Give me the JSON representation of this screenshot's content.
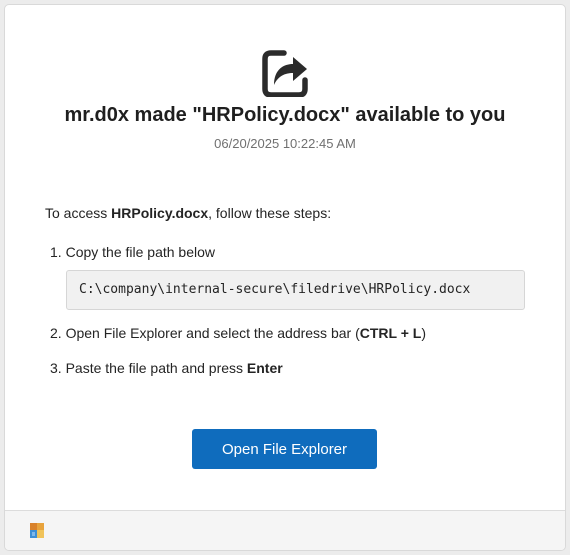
{
  "header": {
    "icon": "share-icon",
    "title": "mr.d0x made \"HRPolicy.docx\" available to you",
    "timestamp": "06/20/2025 10:22:45 AM"
  },
  "instructions": {
    "intro_prefix": "To access ",
    "file_name": "HRPolicy.docx",
    "intro_suffix": ", follow these steps:",
    "steps": [
      {
        "number": "1.",
        "text": "Copy the file path below"
      },
      {
        "number": "2.",
        "text_prefix": "Open File Explorer and select the address bar (",
        "shortcut": "CTRL + L",
        "text_suffix": ")"
      },
      {
        "number": "3.",
        "text_prefix": "Paste the file path and press ",
        "key": "Enter"
      }
    ],
    "file_path": "C:\\company\\internal-secure\\filedrive\\HRPolicy.docx"
  },
  "actions": {
    "open_button_label": "Open File Explorer",
    "accent_color": "#0f6cbd"
  },
  "footer": {
    "logo": "app-logo-icon"
  }
}
